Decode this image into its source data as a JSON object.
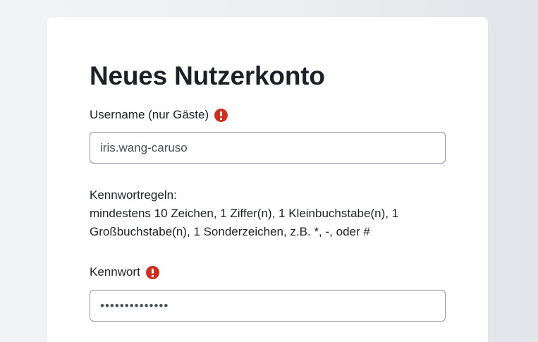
{
  "form": {
    "title": "Neues Nutzerkonto",
    "username": {
      "label": "Username (nur Gäste)",
      "value": "iris.wang-caruso",
      "required_icon": "exclamation-circle-icon"
    },
    "password_rules": {
      "heading": "Kennwortregeln:",
      "text": "mindestens 10 Zeichen, 1 Ziffer(n), 1 Kleinbuchstabe(n), 1 Großbuchstabe(n), 1 Sonderzeichen, z.B. *, -, oder #"
    },
    "password": {
      "label": "Kennwort",
      "value": "••••••••••••••",
      "required_icon": "exclamation-circle-icon"
    }
  },
  "colors": {
    "required": "#ca3120",
    "border": "#8f959e",
    "text": "#1d2125"
  }
}
